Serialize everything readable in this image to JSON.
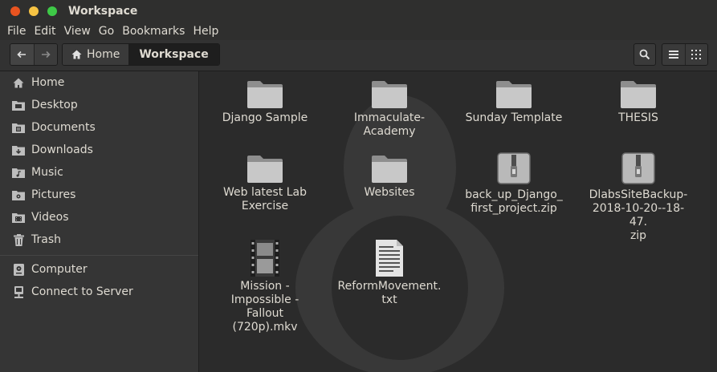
{
  "window": {
    "title": "Workspace"
  },
  "menu": [
    "File",
    "Edit",
    "View",
    "Go",
    "Bookmarks",
    "Help"
  ],
  "breadcrumb": {
    "home": "Home",
    "current": "Workspace"
  },
  "sidebar": {
    "places": [
      {
        "label": "Home",
        "icon": "home-icon"
      },
      {
        "label": "Desktop",
        "icon": "desktop-folder-icon"
      },
      {
        "label": "Documents",
        "icon": "documents-folder-icon"
      },
      {
        "label": "Downloads",
        "icon": "downloads-folder-icon"
      },
      {
        "label": "Music",
        "icon": "music-folder-icon"
      },
      {
        "label": "Pictures",
        "icon": "pictures-folder-icon"
      },
      {
        "label": "Videos",
        "icon": "videos-folder-icon"
      },
      {
        "label": "Trash",
        "icon": "trash-icon"
      }
    ],
    "network": [
      {
        "label": "Computer",
        "icon": "computer-icon"
      },
      {
        "label": "Connect to Server",
        "icon": "server-icon"
      }
    ]
  },
  "files": [
    {
      "name": "Django Sample",
      "type": "folder"
    },
    {
      "name": "Immaculate-\nAcademy",
      "type": "folder"
    },
    {
      "name": "Sunday Template",
      "type": "folder"
    },
    {
      "name": "THESIS",
      "type": "folder"
    },
    {
      "name": "Web latest Lab\nExercise",
      "type": "folder"
    },
    {
      "name": "Websites",
      "type": "folder"
    },
    {
      "name": "back_up_Django_\nfirst_project.zip",
      "type": "zip"
    },
    {
      "name": "DlabsSiteBackup-\n2018-10-20--18-47.\nzip",
      "type": "zip"
    },
    {
      "name": "Mission -\nImpossible - Fallout\n(720p).mkv",
      "type": "video"
    },
    {
      "name": "ReformMovement.\ntxt",
      "type": "text"
    }
  ],
  "colors": {
    "accent": "#e95420",
    "window_bg": "#2b2b2b",
    "sidebar_bg": "#353535"
  }
}
